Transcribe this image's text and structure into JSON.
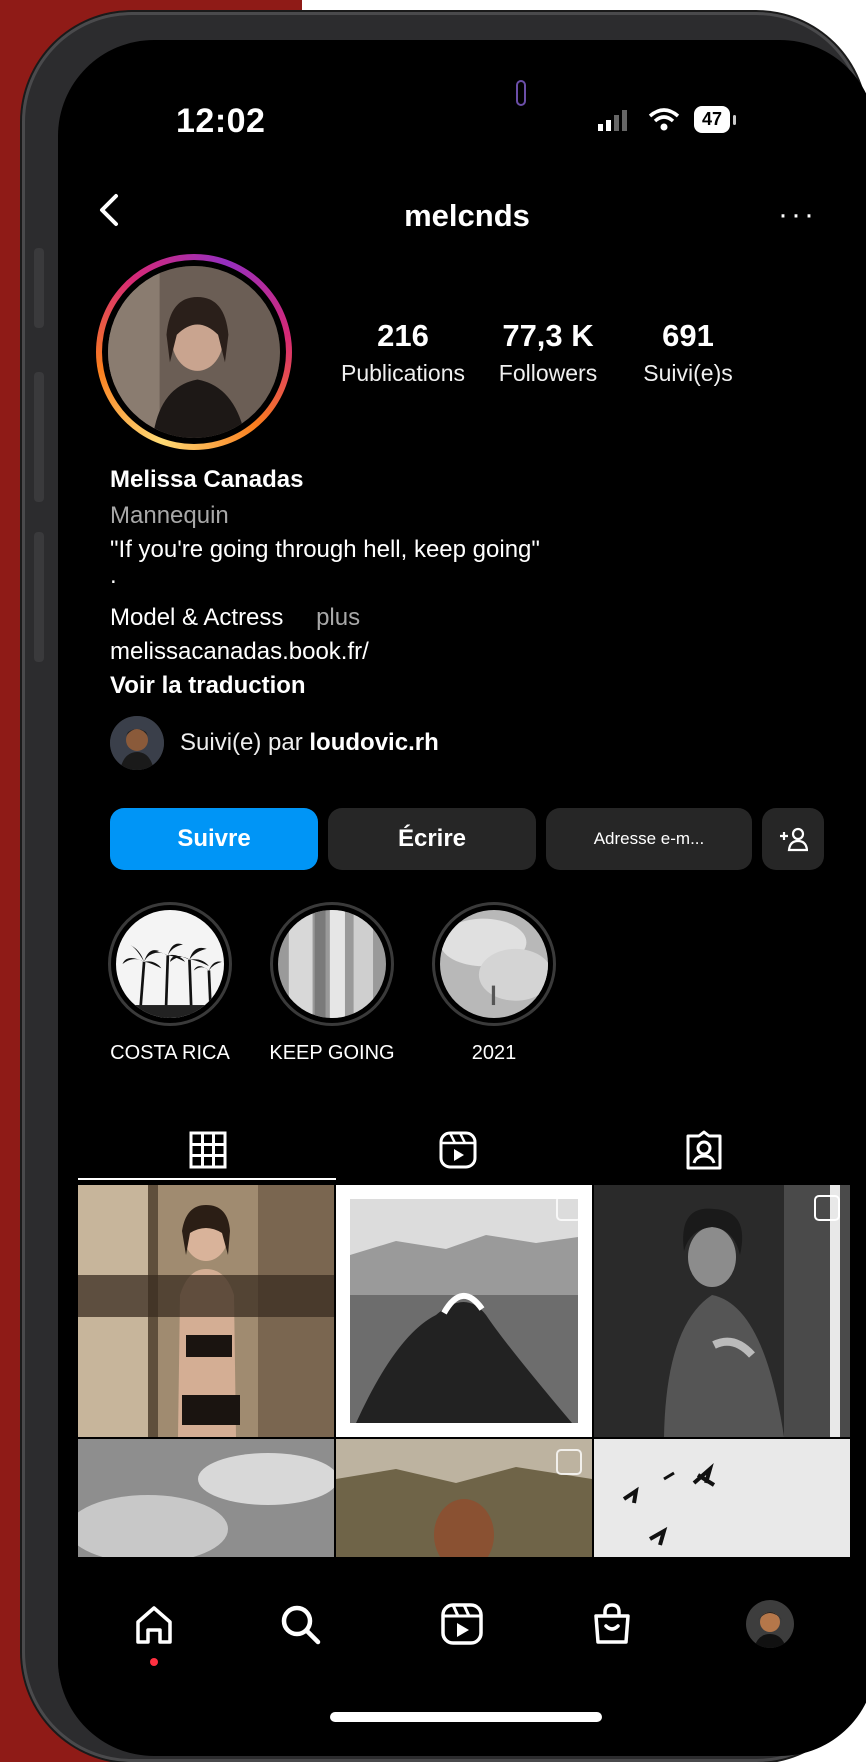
{
  "status_bar": {
    "time": "12:02",
    "battery": "47"
  },
  "header": {
    "username": "melcnds",
    "more": "···"
  },
  "stats": [
    {
      "value": "216",
      "label": "Publications"
    },
    {
      "value": "77,3 K",
      "label": "Followers"
    },
    {
      "value": "691",
      "label": "Suivi(e)s"
    }
  ],
  "bio": {
    "name": "Melissa Canadas",
    "category": "Mannequin",
    "quote": "\"If you're going through hell, keep going\"",
    "dot": ".",
    "line": "Model & Actress",
    "more": "plus",
    "link": "melissacanadas.book.fr/",
    "translate": "Voir la traduction"
  },
  "followed_by": {
    "prefix": "Suivi(e) par",
    "user": "loudovic.rh"
  },
  "buttons": {
    "follow": "Suivre",
    "message": "Écrire",
    "email": "Adresse e-m...",
    "add_user": "+"
  },
  "highlights": [
    {
      "label": "COSTA RICA"
    },
    {
      "label": "KEEP GOING"
    },
    {
      "label": "2021"
    }
  ],
  "tabs": [
    "grid-icon",
    "reels-icon",
    "tagged-icon"
  ],
  "bottom_nav": [
    "home-icon",
    "search-icon",
    "reels-icon",
    "shop-icon",
    "profile-avatar"
  ],
  "colors": {
    "accent": "#0095f6",
    "background": "#000000",
    "surface": "#262626",
    "frame_red": "#8f1b17"
  }
}
